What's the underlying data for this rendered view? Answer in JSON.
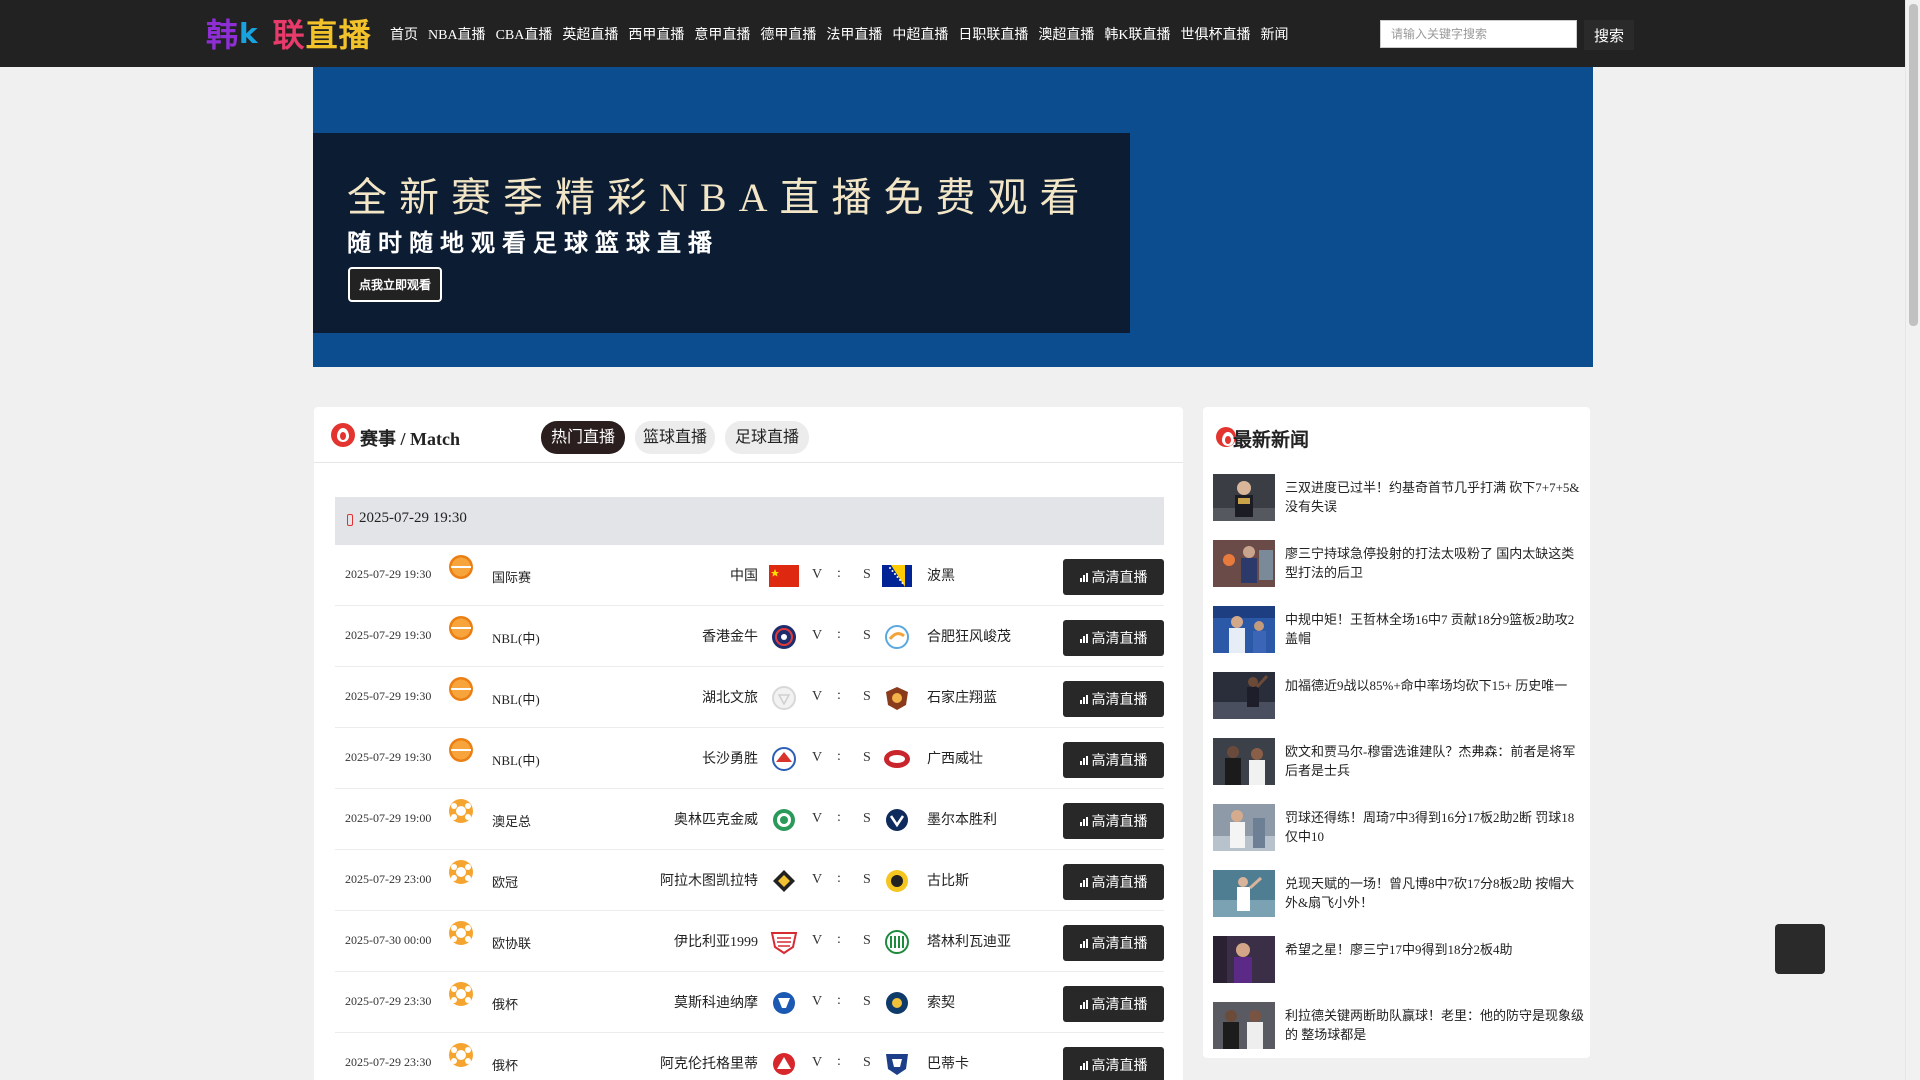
{
  "logo": {
    "part1": "韩",
    "part2": "k",
    "part3": "联",
    "part4": "直播"
  },
  "nav": [
    "首页",
    "NBA直播",
    "CBA直播",
    "英超直播",
    "西甲直播",
    "意甲直播",
    "德甲直播",
    "法甲直播",
    "中超直播",
    "日职联直播",
    "澳超直播",
    "韩K联直播",
    "世俱杯直播",
    "新闻"
  ],
  "search": {
    "placeholder": "请输入关键字搜索",
    "button": "搜索"
  },
  "banner": {
    "title": "全新赛季精彩NBA直播免费观看",
    "subtitle": "随时随地观看足球篮球直播",
    "button": "点我立即观看"
  },
  "main": {
    "title": "赛事 / Match",
    "tabs": [
      {
        "label": "热门直播",
        "active": true
      },
      {
        "label": "篮球直播",
        "active": false
      },
      {
        "label": "足球直播",
        "active": false
      }
    ],
    "date_header": "2025-07-29 19:30",
    "live_label": "高清直播",
    "matches": [
      {
        "time": "2025-07-29 19:30",
        "sport": "basketball",
        "league": "国际赛",
        "home": "中国",
        "away": "波黑",
        "v": "V",
        "colon": ":",
        "s": "S"
      },
      {
        "time": "2025-07-29 19:30",
        "sport": "basketball",
        "league": "NBL(中)",
        "home": "香港金牛",
        "away": "合肥狂风峻茂",
        "v": "V",
        "colon": ":",
        "s": "S"
      },
      {
        "time": "2025-07-29 19:30",
        "sport": "basketball",
        "league": "NBL(中)",
        "home": "湖北文旅",
        "away": "石家庄翔蓝",
        "v": "V",
        "colon": ":",
        "s": "S"
      },
      {
        "time": "2025-07-29 19:30",
        "sport": "basketball",
        "league": "NBL(中)",
        "home": "长沙勇胜",
        "away": "广西威壮",
        "v": "V",
        "colon": ":",
        "s": "S"
      },
      {
        "time": "2025-07-29 19:00",
        "sport": "football",
        "league": "澳足总",
        "home": "奥林匹克金威",
        "away": "墨尔本胜利",
        "v": "V",
        "colon": ":",
        "s": "S"
      },
      {
        "time": "2025-07-29 23:00",
        "sport": "football",
        "league": "欧冠",
        "home": "阿拉木图凯拉特",
        "away": "古比斯",
        "v": "V",
        "colon": ":",
        "s": "S"
      },
      {
        "time": "2025-07-30 00:00",
        "sport": "football",
        "league": "欧协联",
        "home": "伊比利亚1999",
        "away": "塔林利瓦迪亚",
        "v": "V",
        "colon": ":",
        "s": "S"
      },
      {
        "time": "2025-07-29 23:30",
        "sport": "football",
        "league": "俄杯",
        "home": "莫斯科迪纳摩",
        "away": "索契",
        "v": "V",
        "colon": ":",
        "s": "S"
      },
      {
        "time": "2025-07-29 23:30",
        "sport": "football",
        "league": "俄杯",
        "home": "阿克伦托格里蒂",
        "away": "巴蒂卡",
        "v": "V",
        "colon": ":",
        "s": "S"
      }
    ]
  },
  "news": {
    "title": "最新新闻",
    "items": [
      "三双进度已过半！约基奇首节几乎打满 砍下7+7+5&没有失误",
      "廖三宁持球急停投射的打法太吸粉了 国内太缺这类型打法的后卫",
      "中规中矩！王哲林全场16中7 贡献18分9篮板2助攻2盖帽",
      "加福德近9战以85%+命中率场均砍下15+ 历史唯一",
      "欧文和贾马尔-穆雷选谁建队？杰弗森：前者是将军 后者是士兵",
      "罚球还得练！周琦7中3得到16分17板2助2断 罚球18仅中10",
      "兑现天赋的一场！曾凡博8中7砍17分8板2助 按帽大外&扇飞小外！",
      "希望之星！廖三宁17中9得到18分2板4助",
      "利拉德关键两断助队赢球！老里：他的防守是现象级的 整场球都是"
    ]
  },
  "colors": {
    "topbar": "#222222",
    "banner": "#0c4d8f",
    "banner_inner": "#0b1c33",
    "accent_red": "#e3342f",
    "button_dark": "#282828"
  }
}
